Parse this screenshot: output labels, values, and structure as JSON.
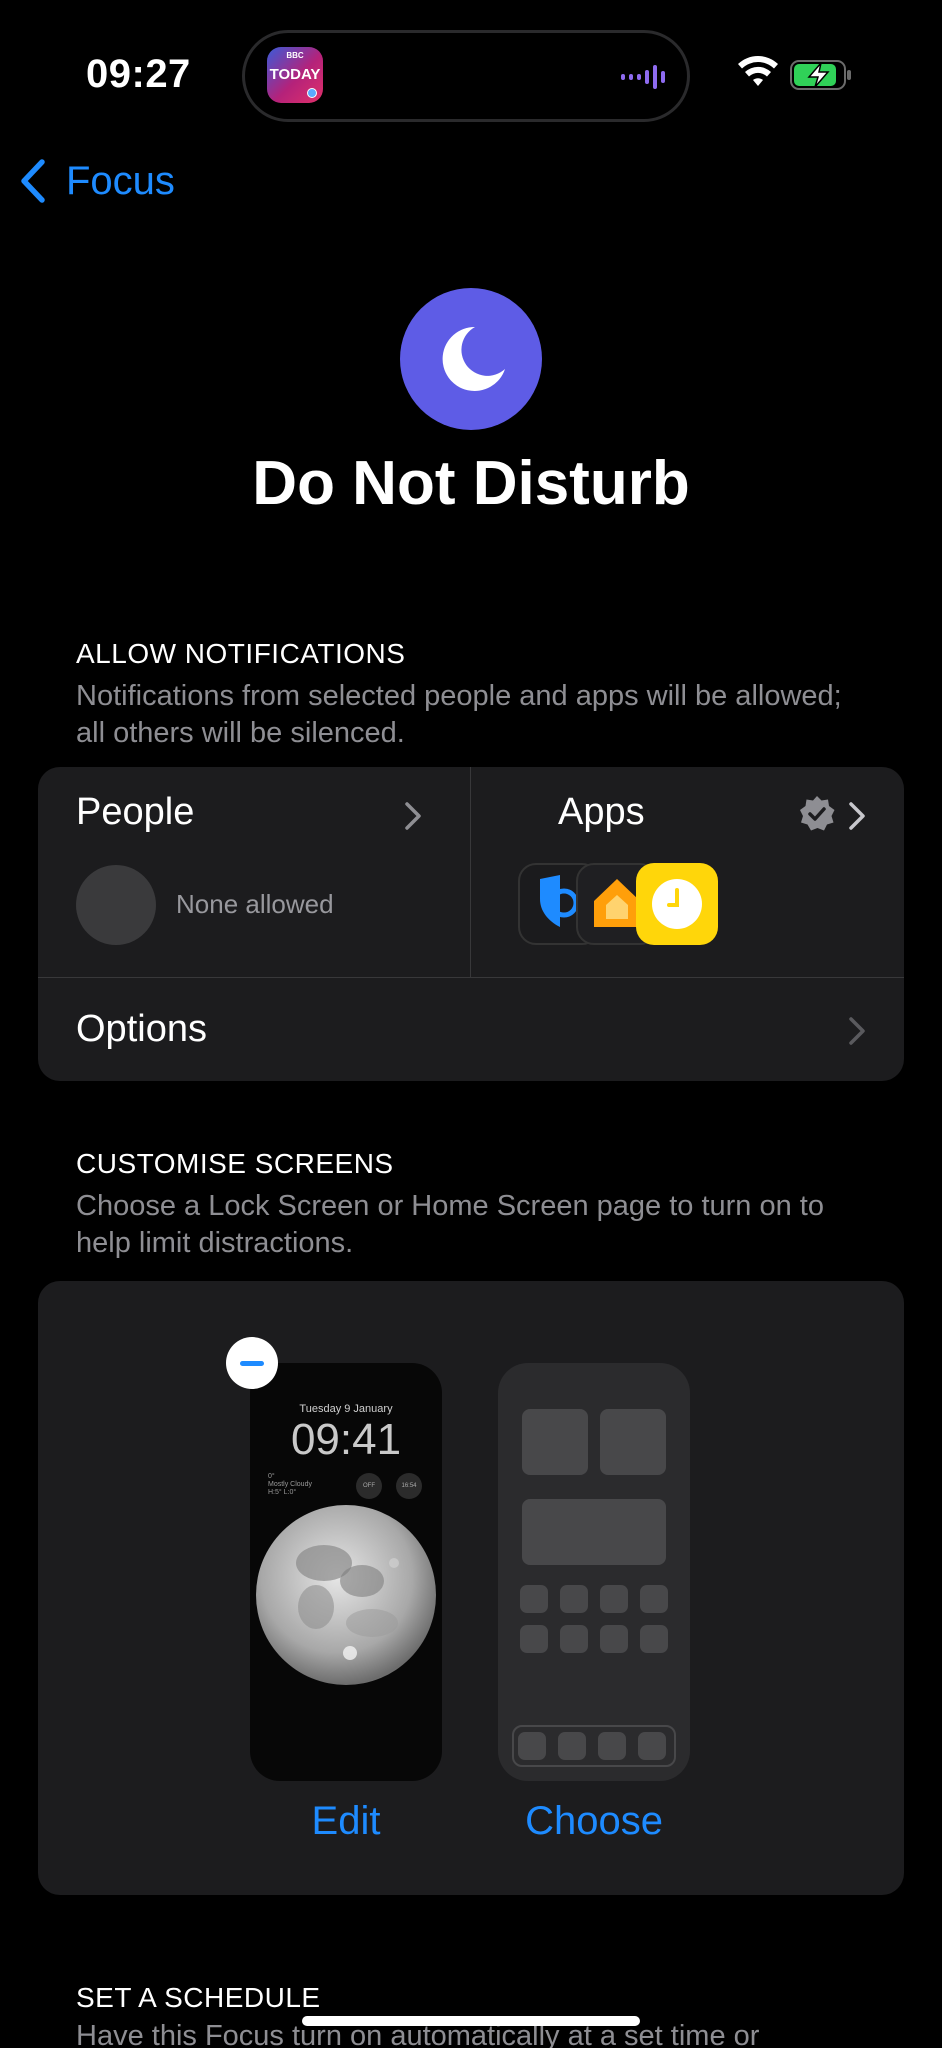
{
  "status_bar": {
    "time": "09:27",
    "live_activity": {
      "app_brand": "BBC",
      "app_label": "TODAY"
    }
  },
  "nav": {
    "back_label": "Focus"
  },
  "focus": {
    "title": "Do Not Disturb",
    "icon": "moon-icon",
    "accent_color": "#5e5ce6"
  },
  "allow_notifications": {
    "header": "ALLOW NOTIFICATIONS",
    "footer": "Notifications from selected people and apps will be allowed; all others will be silenced.",
    "people": {
      "label": "People",
      "status": "None allowed"
    },
    "apps": {
      "label": "Apps",
      "icons": [
        "shield-app-icon",
        "home-app-icon",
        "clock-app-icon"
      ]
    },
    "options": {
      "label": "Options"
    }
  },
  "customise_screens": {
    "header": "CUSTOMISE SCREENS",
    "footer": "Choose a Lock Screen or Home Screen page to turn on to help limit distractions.",
    "lock_screen": {
      "date": "Tuesday 9 January",
      "time": "09:41",
      "weather_temp": "0°",
      "weather_desc": "Mostly Cloudy",
      "weather_range": "H:5° L:0°",
      "widget_1": "OFF",
      "widget_2": "16:54",
      "action": "Edit"
    },
    "home_screen": {
      "action": "Choose"
    }
  },
  "schedule": {
    "header": "SET A SCHEDULE",
    "footer": "Have this Focus turn on automatically at a set time or"
  },
  "colors": {
    "link": "#1e8bff",
    "background": "#000000",
    "card": "#1c1c1e"
  }
}
